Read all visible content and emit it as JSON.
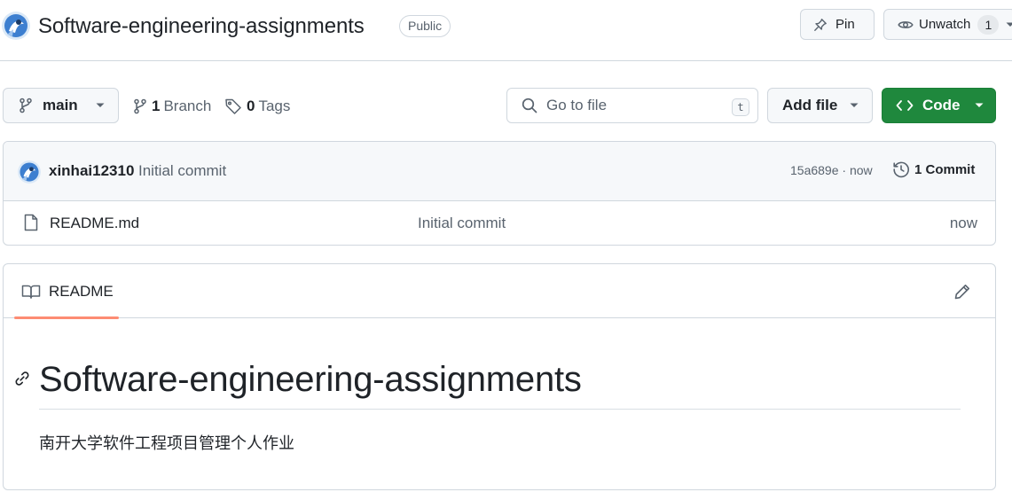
{
  "repo": {
    "name": "Software-engineering-assignments",
    "visibility": "Public"
  },
  "header_actions": {
    "pin_label": "Pin",
    "watch_label": "Unwatch",
    "watch_count": "1"
  },
  "toolbar": {
    "branch": "main",
    "branches_count": "1",
    "branches_label": "Branch",
    "tags_count": "0",
    "tags_label": "Tags",
    "search_placeholder": "Go to file",
    "search_shortcut": "t",
    "add_file_label": "Add file",
    "code_label": "Code"
  },
  "latest_commit": {
    "author": "xinhai12310",
    "message": "Initial commit",
    "meta": "15a689e · now",
    "history_label": "1 Commit"
  },
  "files": [
    {
      "name": "README.md",
      "commit_message": "Initial commit",
      "age": "now"
    }
  ],
  "readme": {
    "tab_label": "README",
    "heading": "Software-engineering-assignments",
    "paragraph": "南开大学软件工程项目管理个人作业"
  },
  "colors": {
    "primary_green": "#1f883d",
    "tab_underline": "#fd8c73",
    "border": "#d0d7de",
    "muted_text": "#59636e"
  },
  "icons": [
    "repo-avatar",
    "pin-icon",
    "eye-icon",
    "git-branch-icon",
    "tag-icon",
    "search-icon",
    "code-icon",
    "history-icon",
    "file-icon",
    "book-icon",
    "pencil-icon",
    "link-icon"
  ]
}
